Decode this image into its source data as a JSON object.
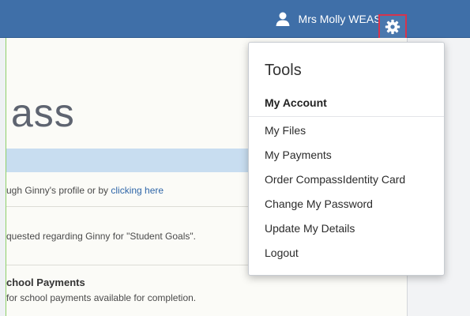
{
  "header": {
    "user_name": "Mrs Molly WEASLEY",
    "user_icon": "person-icon",
    "settings_icon": "gear-icon",
    "bar_color": "#3f6fa8",
    "highlight_color": "#d6344d"
  },
  "page": {
    "title_fragment": "ass",
    "line1_prefix": "ugh Ginny's profile or by ",
    "line1_link": "clicking here",
    "line2": "quested regarding Ginny for \"Student Goals\".",
    "section_heading": "chool Payments",
    "section_text": "for school payments available for completion."
  },
  "menu": {
    "title": "Tools",
    "heading": "My Account",
    "items": [
      "My Files",
      "My Payments",
      "Order CompassIdentity Card",
      "Change My Password",
      "Update My Details",
      "Logout"
    ]
  }
}
